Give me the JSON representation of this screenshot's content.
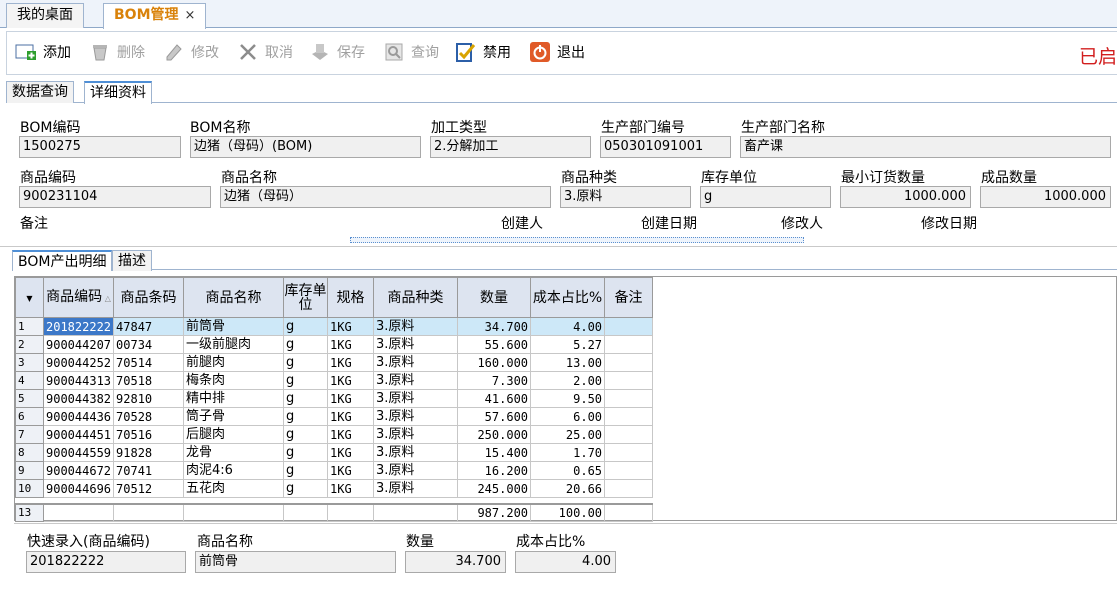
{
  "top_tabs": {
    "desk": "我的桌面",
    "bom": "BOM管理",
    "close": "×"
  },
  "toolbar": {
    "add": "添加",
    "delete": "删除",
    "edit": "修改",
    "cancel": "取消",
    "save": "保存",
    "query": "查询",
    "disable": "禁用",
    "exit": "退出"
  },
  "status": "已启",
  "sub_tabs": {
    "query": "数据查询",
    "detail": "详细资料"
  },
  "form": {
    "bom_code_label": "BOM编码",
    "bom_code": "1500275",
    "bom_name_label": "BOM名称",
    "bom_name": "边猪（母码）(BOM)",
    "process_type_label": "加工类型",
    "process_type": "2.分解加工",
    "dept_code_label": "生产部门编号",
    "dept_code": "050301091001",
    "dept_name_label": "生产部门名称",
    "dept_name": "畜产课",
    "item_code_label": "商品编码",
    "item_code": "900231104",
    "item_name_label": "商品名称",
    "item_name": "边猪（母码）",
    "item_category_label": "商品种类",
    "item_category": "3.原料",
    "stock_unit_label": "库存单位",
    "stock_unit": "g",
    "min_order_label": "最小订货数量",
    "min_order": "1000.000",
    "product_qty_label": "成品数量",
    "product_qty": "1000.000",
    "remark_label": "备注",
    "creator_label": "创建人",
    "create_date_label": "创建日期",
    "modifier_label": "修改人",
    "modify_date_label": "修改日期"
  },
  "detail_tabs": {
    "output": "BOM产出明细",
    "desc": "描述"
  },
  "grid": {
    "headers": [
      "商品编码",
      "商品条码",
      "商品名称",
      "库存单位",
      "规格",
      "商品种类",
      "数量",
      "成本占比%",
      "备注"
    ],
    "rows": [
      {
        "n": "1",
        "code": "201822222",
        "barcode": "47847",
        "name": "前筒骨",
        "unit": "g",
        "spec": "1KG",
        "cat": "3.原料",
        "qty": "34.700",
        "ratio": "4.00",
        "remark": ""
      },
      {
        "n": "2",
        "code": "900044207",
        "barcode": "00734",
        "name": "一级前腿肉",
        "unit": "g",
        "spec": "1KG",
        "cat": "3.原料",
        "qty": "55.600",
        "ratio": "5.27",
        "remark": ""
      },
      {
        "n": "3",
        "code": "900044252",
        "barcode": "70514",
        "name": "前腿肉",
        "unit": "g",
        "spec": "1KG",
        "cat": "3.原料",
        "qty": "160.000",
        "ratio": "13.00",
        "remark": ""
      },
      {
        "n": "4",
        "code": "900044313",
        "barcode": "70518",
        "name": "梅条肉",
        "unit": "g",
        "spec": "1KG",
        "cat": "3.原料",
        "qty": "7.300",
        "ratio": "2.00",
        "remark": ""
      },
      {
        "n": "5",
        "code": "900044382",
        "barcode": "92810",
        "name": "精中排",
        "unit": "g",
        "spec": "1KG",
        "cat": "3.原料",
        "qty": "41.600",
        "ratio": "9.50",
        "remark": ""
      },
      {
        "n": "6",
        "code": "900044436",
        "barcode": "70528",
        "name": "筒子骨",
        "unit": "g",
        "spec": "1KG",
        "cat": "3.原料",
        "qty": "57.600",
        "ratio": "6.00",
        "remark": ""
      },
      {
        "n": "7",
        "code": "900044451",
        "barcode": "70516",
        "name": "后腿肉",
        "unit": "g",
        "spec": "1KG",
        "cat": "3.原料",
        "qty": "250.000",
        "ratio": "25.00",
        "remark": ""
      },
      {
        "n": "8",
        "code": "900044559",
        "barcode": "91828",
        "name": "龙骨",
        "unit": "g",
        "spec": "1KG",
        "cat": "3.原料",
        "qty": "15.400",
        "ratio": "1.70",
        "remark": ""
      },
      {
        "n": "9",
        "code": "900044672",
        "barcode": "70741",
        "name": "肉泥4:6",
        "unit": "g",
        "spec": "1KG",
        "cat": "3.原料",
        "qty": "16.200",
        "ratio": "0.65",
        "remark": ""
      },
      {
        "n": "10",
        "code": "900044696",
        "barcode": "70512",
        "name": "五花肉",
        "unit": "g",
        "spec": "1KG",
        "cat": "3.原料",
        "qty": "245.000",
        "ratio": "20.66",
        "remark": ""
      }
    ],
    "total": {
      "n": "13",
      "qty": "987.200",
      "ratio": "100.00"
    }
  },
  "quick": {
    "code_label": "快速录入(商品编码)",
    "code": "201822222",
    "name_label": "商品名称",
    "name": "前筒骨",
    "qty_label": "数量",
    "qty": "34.700",
    "ratio_label": "成本占比%",
    "ratio": "4.00"
  }
}
